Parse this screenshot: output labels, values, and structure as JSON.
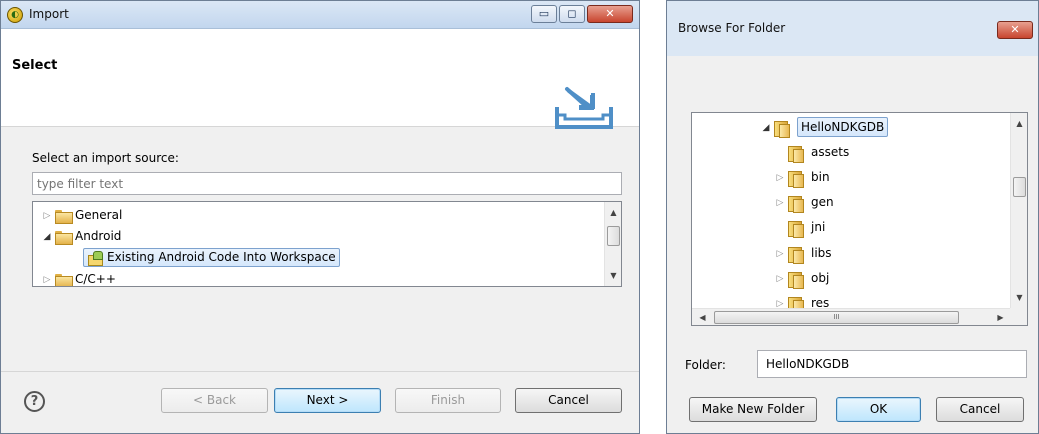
{
  "import_dialog": {
    "title": "Import",
    "window_controls": {
      "minimize": "▭",
      "maximize": "◻",
      "close": "✕"
    },
    "banner_title": "Select",
    "source_label": "Select an import source:",
    "filter_placeholder": "type filter text",
    "tree": [
      {
        "label": "General",
        "state": "collapsed"
      },
      {
        "label": "Android",
        "state": "expanded"
      },
      {
        "label": "Existing Android Code Into Workspace",
        "state": "selected"
      },
      {
        "label": "C/C++",
        "state": "collapsed"
      }
    ],
    "buttons": {
      "help": "?",
      "back": "< Back",
      "next": "Next >",
      "finish": "Finish",
      "cancel": "Cancel"
    }
  },
  "browse_dialog": {
    "title": "Browse For Folder",
    "close": "✕",
    "tree": [
      {
        "label": "HelloNDKGDB",
        "state": "expanded-selected"
      },
      {
        "label": "assets",
        "state": "leaf"
      },
      {
        "label": "bin",
        "state": "collapsed"
      },
      {
        "label": "gen",
        "state": "collapsed"
      },
      {
        "label": "jni",
        "state": "leaf"
      },
      {
        "label": "libs",
        "state": "collapsed"
      },
      {
        "label": "obj",
        "state": "collapsed"
      },
      {
        "label": "res",
        "state": "collapsed"
      }
    ],
    "folder_label": "Folder:",
    "folder_value": "HelloNDKGDB",
    "buttons": {
      "make_new_folder": "Make New Folder",
      "ok": "OK",
      "cancel": "Cancel"
    }
  },
  "icons": {
    "tree_collapsed": "▷",
    "tree_expanded": "◢",
    "scroll_up": "▲",
    "scroll_down": "▼",
    "scroll_left": "◀",
    "scroll_right": "▶",
    "scroll_grip": "III"
  }
}
